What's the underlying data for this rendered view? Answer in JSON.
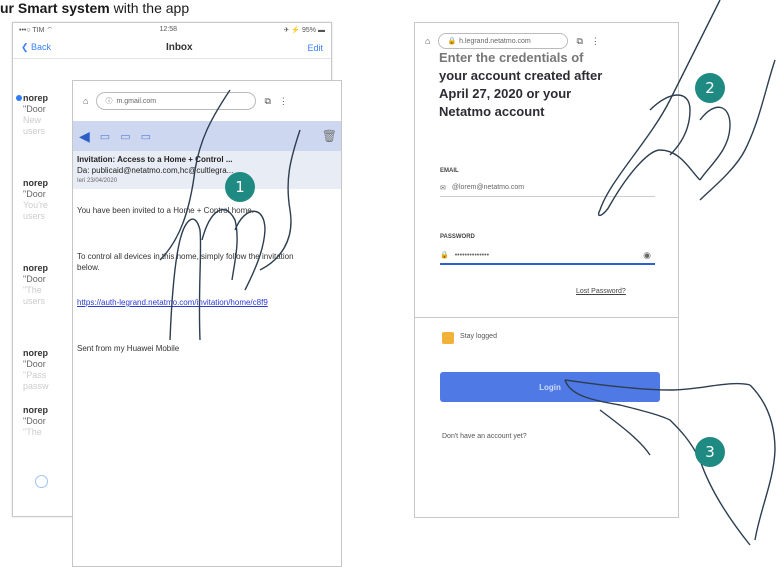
{
  "heading": {
    "bold": "ur Smart system",
    "rest": " with the app"
  },
  "inbox": {
    "status_left": "•••○ TIM ⌔",
    "status_time": "12:58",
    "status_right": "✈ ⚡ 95% ▬",
    "back": "❮ Back",
    "title": "Inbox",
    "edit": "Edit",
    "items": [
      {
        "from": "norep",
        "l1": "\"Door",
        "l2": "New",
        "l3": "users"
      },
      {
        "from": "norep",
        "l1": "\"Door",
        "l2": "You're",
        "l3": "users"
      },
      {
        "from": "norep",
        "l1": "\"Door",
        "l2": "\"The",
        "l3": "users"
      },
      {
        "from": "norep",
        "l1": "\"Door",
        "l2": "\"Pass",
        "l3": "passw"
      },
      {
        "from": "norep",
        "l1": "\"Door",
        "l2": "\"The",
        "l3": ""
      }
    ]
  },
  "email": {
    "url": "m.gmail.com",
    "subject": "Invitation: Access to a Home + Control ...",
    "from": "Da: publicaid@netatmo.com,hc@cultlegra...",
    "date": "Ieri 23/04/2020",
    "body1": "You have been invited to a Home + Control home.",
    "body2": "To control all devices in this home, simply follow the invitation below.",
    "link": "https://auth-legrand.netatmo.com/invitation/home/c8f9",
    "sign": "Sent from my Huawei Mobile"
  },
  "login": {
    "url": "h.legrand.netatmo.com",
    "title_lines": [
      "Enter the credentials of",
      "your account created after",
      "April 27, 2020 or your",
      "Netatmo account"
    ],
    "email_label": "EMAIL",
    "email_value": "@lorem@netatmo.com",
    "password_label": "PASSWORD",
    "password_value": "••••••••••••••",
    "lost_password": "Lost Password?",
    "stay_logged": "Stay logged",
    "login_button": "Login",
    "signup": "Don't have an account yet?"
  },
  "badges": {
    "one": "1",
    "two": "2",
    "three": "3"
  },
  "colors": {
    "badge": "#1f8a82",
    "accent": "#2f5fce",
    "checkbox": "#f2b23a"
  }
}
